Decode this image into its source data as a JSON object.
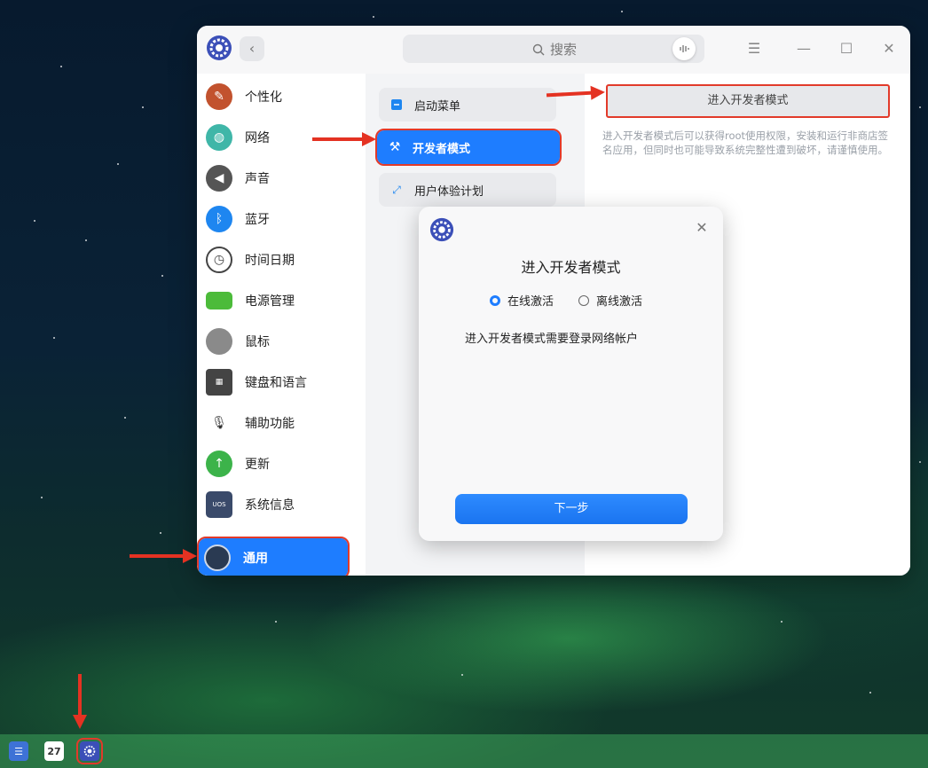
{
  "window": {
    "search_placeholder": "搜索",
    "back_glyph": "‹",
    "menu_glyph": "☰",
    "min_glyph": "—",
    "max_glyph": "☐",
    "close_glyph": "✕"
  },
  "sidebar": {
    "items": [
      {
        "label": "个性化",
        "icon": "personalization-icon"
      },
      {
        "label": "网络",
        "icon": "network-icon"
      },
      {
        "label": "声音",
        "icon": "sound-icon"
      },
      {
        "label": "蓝牙",
        "icon": "bluetooth-icon"
      },
      {
        "label": "时间日期",
        "icon": "clock-icon"
      },
      {
        "label": "电源管理",
        "icon": "battery-icon"
      },
      {
        "label": "鼠标",
        "icon": "mouse-icon"
      },
      {
        "label": "键盘和语言",
        "icon": "keyboard-icon"
      },
      {
        "label": "辅助功能",
        "icon": "microphone-icon"
      },
      {
        "label": "更新",
        "icon": "update-icon"
      },
      {
        "label": "系统信息",
        "icon": "system-info-icon"
      },
      {
        "label": "通用",
        "icon": "general-icon"
      }
    ],
    "active_index": 11
  },
  "submenu": {
    "items": [
      {
        "label": "启动菜单"
      },
      {
        "label": "开发者模式"
      },
      {
        "label": "用户体验计划"
      }
    ],
    "active_index": 1
  },
  "panel": {
    "button_label": "进入开发者模式",
    "description": "进入开发者模式后可以获得root使用权限，安装和运行非商店签名应用，但同时也可能导致系统完整性遭到破坏，请谨慎使用。"
  },
  "dialog": {
    "title": "进入开发者模式",
    "options": [
      "在线激活",
      "离线激活"
    ],
    "selected_option": 0,
    "message": "进入开发者模式需要登录网络帐户",
    "next_label": "下一步",
    "close_glyph": "✕"
  },
  "dock": {
    "calendar_day": "27"
  },
  "colors": {
    "accent": "#1e7dff",
    "annotation": "#e43222"
  }
}
